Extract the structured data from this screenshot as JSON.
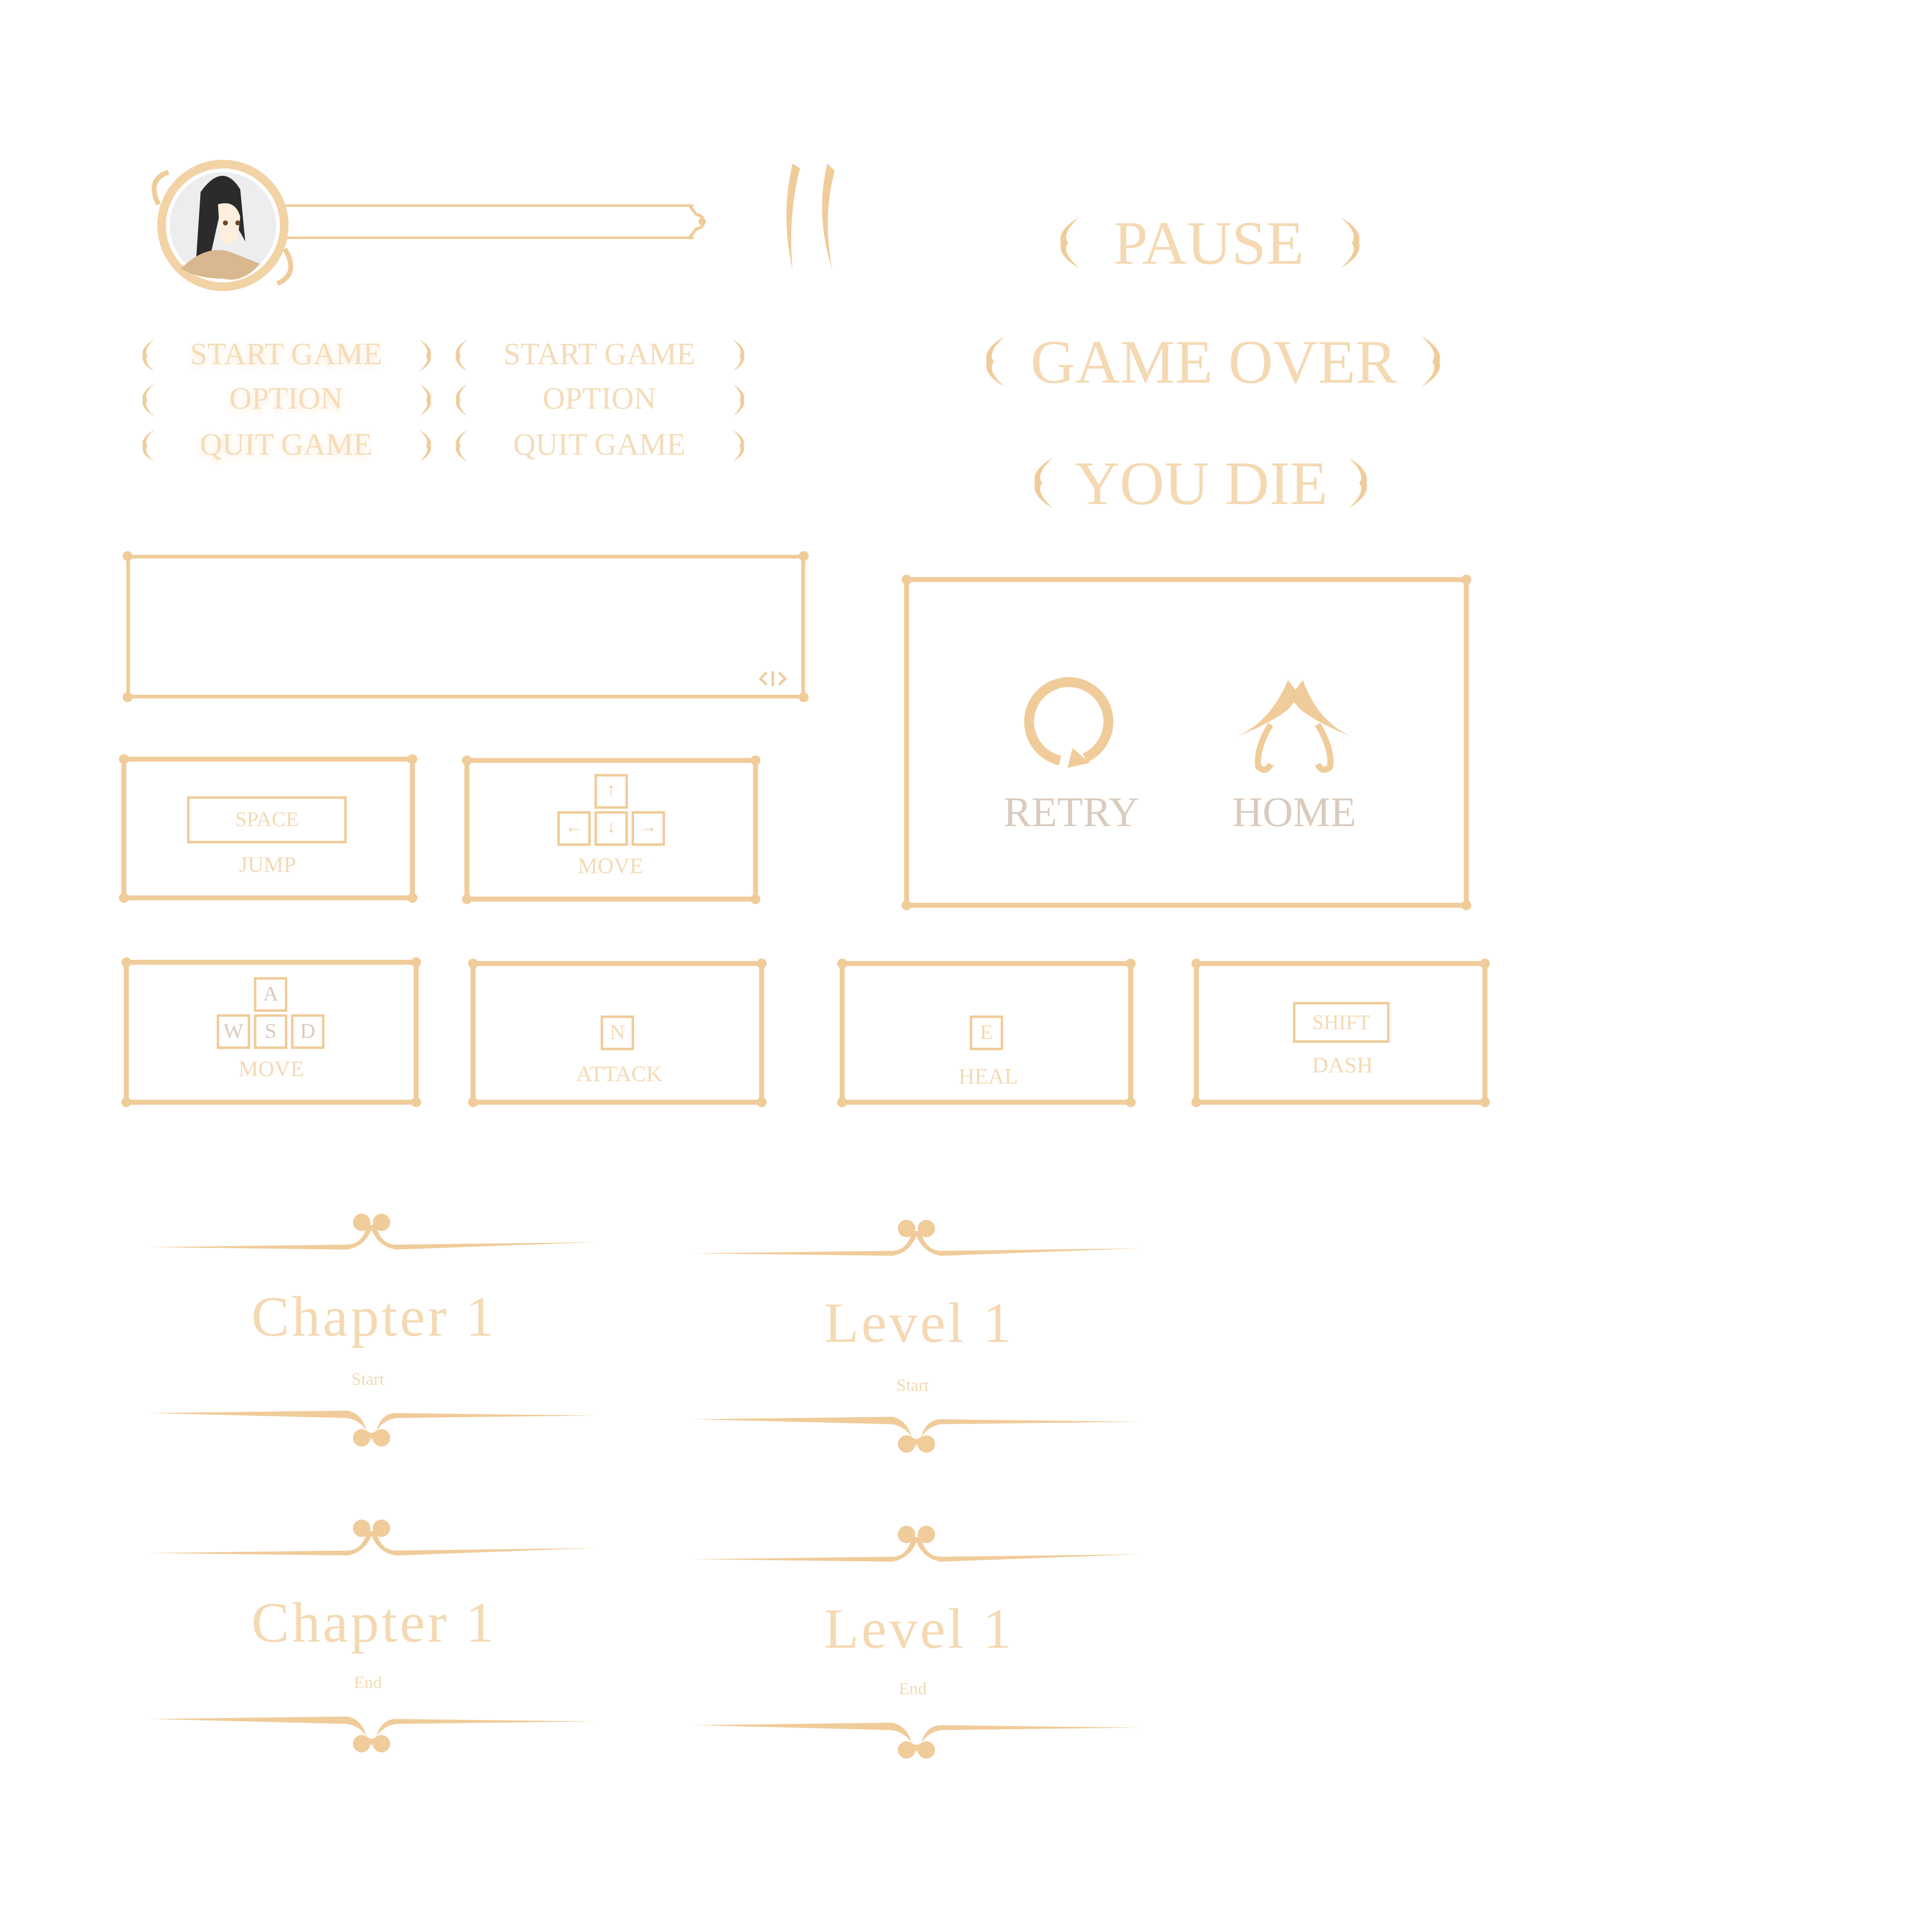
{
  "colors": {
    "accent": "#f0cc9a",
    "text_faint": "#fcebd3",
    "text_muted": "#d9cbbd"
  },
  "hud": {
    "portrait_icon": "character-portrait",
    "health_bar_value": 0,
    "pause_icon": "pause-icon"
  },
  "titles": {
    "pause": "PAUSE",
    "game_over": "GAME OVER",
    "you_die": "YOU DIE"
  },
  "main_menu": {
    "highlighted": {
      "items": [
        "START GAME",
        "OPTION",
        "QUIT GAME"
      ]
    },
    "normal": {
      "items": [
        "START GAME",
        "OPTION",
        "QUIT GAME"
      ]
    }
  },
  "death_panel": {
    "retry_label": "RETRY",
    "home_label": "HOME",
    "retry_icon": "retry-icon",
    "home_icon": "home-icon"
  },
  "controls": [
    {
      "keys": [
        "SPACE"
      ],
      "action": "JUMP"
    },
    {
      "keys": [
        "↑",
        "←",
        "↓",
        "→"
      ],
      "action": "MOVE"
    },
    {
      "keys": [
        "A",
        "W",
        "S",
        "D"
      ],
      "action": "MOVE"
    },
    {
      "keys": [
        "N"
      ],
      "action": "ATTACK"
    },
    {
      "keys": [
        "E"
      ],
      "action": "HEAL"
    },
    {
      "keys": [
        "SHIFT"
      ],
      "action": "DASH"
    }
  ],
  "banners": [
    {
      "title": "Chapter 1",
      "subtitle": "Start"
    },
    {
      "title": "Level 1",
      "subtitle": "Start"
    },
    {
      "title": "Chapter 1",
      "subtitle": "End"
    },
    {
      "title": "Level 1",
      "subtitle": "End"
    }
  ]
}
